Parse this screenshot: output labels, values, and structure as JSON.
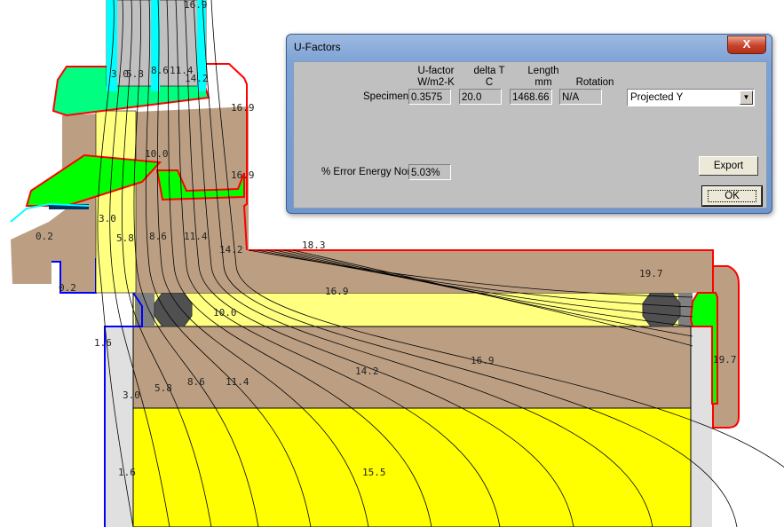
{
  "drawing": {
    "isotherm_labels": [
      "16.9",
      "3.0",
      "5.8",
      "8.6",
      "11.4",
      "14.2",
      "16.9",
      "10.0",
      "16.9",
      "3.0",
      "0.2",
      "5.8",
      "8.6",
      "11.4",
      "14.2",
      "0.2",
      "18.3",
      "19.7",
      "16.9",
      "10.0",
      "1.6",
      "19.7",
      "16.9",
      "14.2",
      "11.4",
      "8.6",
      "5.8",
      "3.0",
      "1.6",
      "15.5"
    ],
    "colors": {
      "wood": "#bc9f82",
      "glass": "#c0c0c0",
      "frame_edge": "#00ffff",
      "insulation_light": "#ffff80",
      "insulation": "#ffff00",
      "seal": "#00ff00",
      "seal_light": "#00ff80",
      "gasket": "#505050",
      "spacer": "#808080",
      "sill": "#e0e0e0",
      "boundary_warm": "#ff0000",
      "boundary_cold": "#0000ff"
    }
  },
  "dialog": {
    "title": "U-Factors",
    "close_label": "X",
    "headers": {
      "ufactor": [
        "U-factor",
        "W/m2-K"
      ],
      "delta_t": [
        "delta T",
        "C"
      ],
      "length": [
        "Length",
        "mm"
      ],
      "rotation": [
        "Rotation"
      ]
    },
    "specimen_label": "Specimen",
    "specimen": {
      "ufactor": "0.3575",
      "delta_t": "20.0",
      "length": "1468.66",
      "rotation": "N/A"
    },
    "projection_select": "Projected Y",
    "error_label": "% Error Energy Norm",
    "error_value": "5.03%",
    "export_label": "Export",
    "ok_label": "OK"
  }
}
